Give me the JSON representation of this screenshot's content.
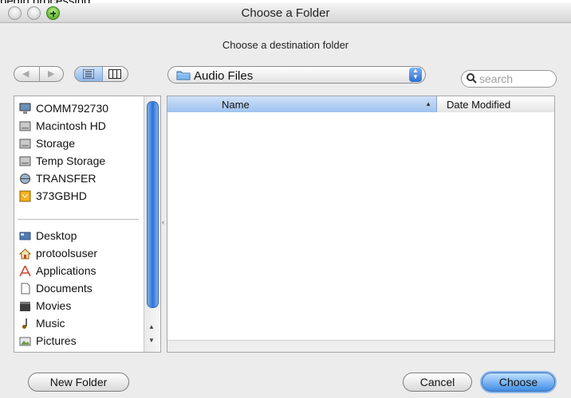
{
  "background_text": "begin processing.",
  "window": {
    "title": "Choose a Folder",
    "subtitle": "Choose a destination folder"
  },
  "toolbar": {
    "location": "Audio Files",
    "search_placeholder": "search"
  },
  "sidebar": {
    "devices": [
      "COMM792730",
      "Macintosh HD",
      "Storage",
      "Temp Storage",
      "TRANSFER",
      "373GBHD"
    ],
    "places": [
      "Desktop",
      "protoolsuser",
      "Applications",
      "Documents",
      "Movies",
      "Music",
      "Pictures"
    ]
  },
  "browser": {
    "columns": [
      "Name",
      "Date Modified"
    ]
  },
  "buttons": {
    "new_folder": "New Folder",
    "cancel": "Cancel",
    "choose": "Choose"
  },
  "colors": {
    "accent": "#3f8de6",
    "selected_column": "#9ec2ef"
  }
}
